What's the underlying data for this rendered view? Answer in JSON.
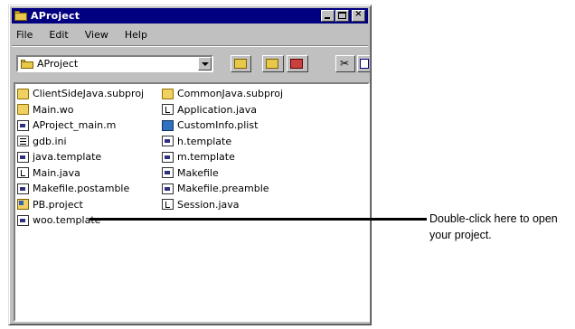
{
  "window": {
    "title": "AProject",
    "controls": {
      "minimize": "_",
      "maximize": "□",
      "close": "×"
    }
  },
  "menu": [
    "File",
    "Edit",
    "View",
    "Help"
  ],
  "toolbar": {
    "location": "AProject",
    "icons": [
      "up-folder-icon",
      "map-drive-icon",
      "disconnect-drive-icon",
      "cut-icon"
    ]
  },
  "files": {
    "left": [
      {
        "name": "ClientSideJava.subproj",
        "icon": "folder-icon"
      },
      {
        "name": "Main.wo",
        "icon": "folder-icon"
      },
      {
        "name": "AProject_main.m",
        "icon": "document-icon"
      },
      {
        "name": "gdb.ini",
        "icon": "ini-file-icon"
      },
      {
        "name": "java.template",
        "icon": "document-icon"
      },
      {
        "name": "Main.java",
        "icon": "java-file-icon"
      },
      {
        "name": "Makefile.postamble",
        "icon": "document-icon"
      },
      {
        "name": "PB.project",
        "icon": "project-file-icon"
      },
      {
        "name": "woo.template",
        "icon": "document-icon"
      }
    ],
    "right": [
      {
        "name": "CommonJava.subproj",
        "icon": "folder-icon"
      },
      {
        "name": "Application.java",
        "icon": "java-file-icon"
      },
      {
        "name": "CustomInfo.plist",
        "icon": "plist-file-icon"
      },
      {
        "name": "h.template",
        "icon": "document-icon"
      },
      {
        "name": "m.template",
        "icon": "document-icon"
      },
      {
        "name": "Makefile",
        "icon": "document-icon"
      },
      {
        "name": "Makefile.preamble",
        "icon": "document-icon"
      },
      {
        "name": "Session.java",
        "icon": "java-file-icon"
      }
    ]
  },
  "callout": {
    "line1": "Double-click here to open",
    "line2": "your project."
  }
}
